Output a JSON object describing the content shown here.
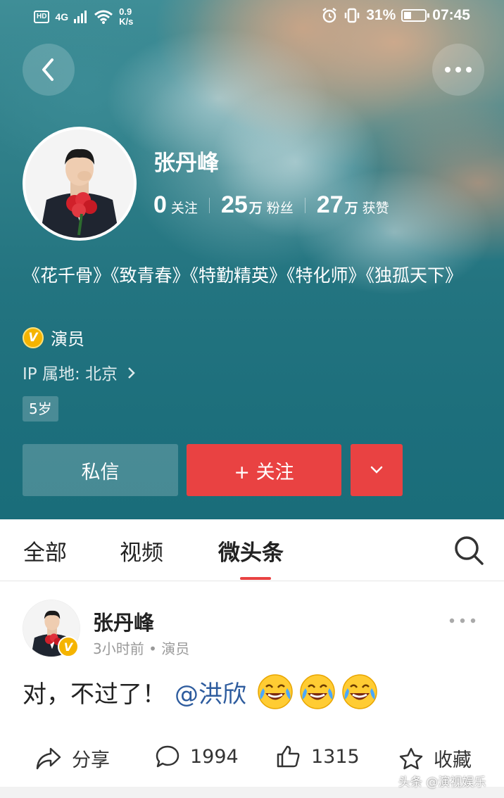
{
  "status_bar": {
    "hd": "HD",
    "network": "4G",
    "speed_value": "0.9",
    "speed_unit": "K/s",
    "battery": "31%",
    "time": "07:45"
  },
  "profile": {
    "name": "张丹峰",
    "stats": [
      {
        "num": "0",
        "unit": "",
        "label": "关注"
      },
      {
        "num": "25",
        "unit": "万",
        "label": "粉丝"
      },
      {
        "num": "27",
        "unit": "万",
        "label": "获赞"
      }
    ],
    "bio": "《花千骨》《致青春》《特勤精英》《特化师》《独孤天下》",
    "verified_badge": "V",
    "role": "演员",
    "ip_location": "IP 属地: 北京",
    "age_tag": "5岁",
    "message_button": "私信",
    "follow_button": "+ 关注"
  },
  "tabs": [
    {
      "label": "全部",
      "active": false
    },
    {
      "label": "视频",
      "active": false
    },
    {
      "label": "微头条",
      "active": true
    }
  ],
  "post": {
    "author": "张丹峰",
    "meta": "3小时前 • 演员",
    "text": "对，不过了！",
    "mention": "@洪欣",
    "emojis": [
      "crying-laughing-emoji",
      "crying-laughing-emoji",
      "crying-laughing-emoji"
    ],
    "actions": {
      "share_label": "分享",
      "comments": "1994",
      "likes": "1315",
      "favorite_label": "收藏"
    }
  },
  "watermark": "头条 @演视娱乐",
  "colors": {
    "accent_red": "#e94242",
    "mention_blue": "#2e5c9e",
    "verified_gold": "#f5b400"
  }
}
